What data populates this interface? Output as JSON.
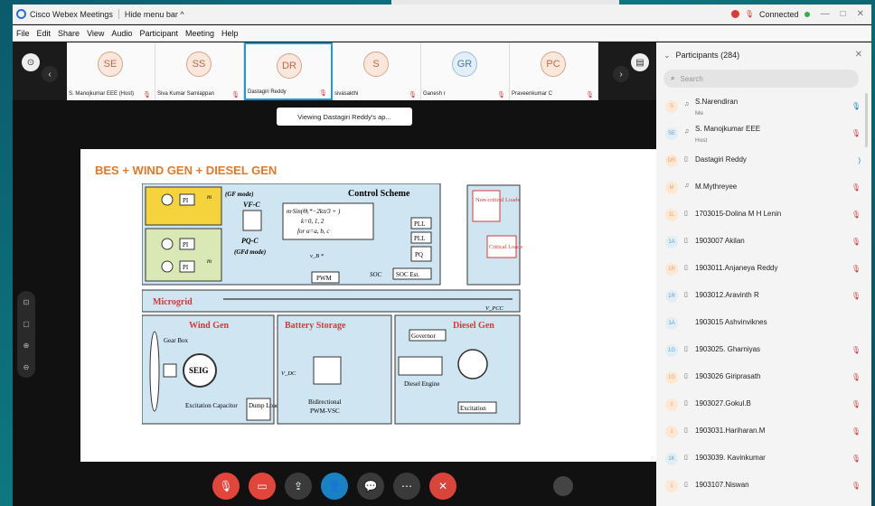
{
  "window": {
    "app_title": "Cisco Webex Meetings",
    "hide_menu": "Hide menu bar ^",
    "status": "Connected"
  },
  "menu": [
    "File",
    "Edit",
    "Share",
    "View",
    "Audio",
    "Participant",
    "Meeting",
    "Help"
  ],
  "thumbnails": [
    {
      "initials": "SE",
      "name": "S. Manojkumar EEE (Host)",
      "color": "orange"
    },
    {
      "initials": "SS",
      "name": "Siva Kumar Samiappan",
      "color": "orange"
    },
    {
      "initials": "DR",
      "name": "Dastagiri Reddy",
      "color": "orange",
      "active": true
    },
    {
      "initials": "S",
      "name": "sivasakthi",
      "color": "orange"
    },
    {
      "initials": "GR",
      "name": "Ganesh r",
      "color": "blue"
    },
    {
      "initials": "PC",
      "name": "Praveenkumar C",
      "color": "orange"
    }
  ],
  "toast": "Viewing Dastagiri Reddy's ap...",
  "slide": {
    "title": "BES + WIND GEN + DIESEL GEN",
    "control_scheme": "Control Scheme",
    "gf_mode": "(GF mode)",
    "vf_c": "VF-C",
    "pq_c": "PQ-C",
    "gfd_mode": "(GFd mode)",
    "formula_1": "m·Sin(Θₑ*−2kπ/3 + )",
    "formula_2": "k=0, 1, 2",
    "formula_3": "for α=a, b, c",
    "pwm": "PWM",
    "pll": "PLL",
    "pq": "PQ",
    "soc_est": "SOC Est.",
    "soc": "SOC",
    "non_critical": "Non-critical Loads",
    "critical": "Critical Loads",
    "microgrid": "Microgrid",
    "vpcc": "V_PCC",
    "wind_gen": "Wind Gen",
    "battery_storage": "Battery Storage",
    "diesel_gen": "Diesel Gen",
    "gear_box": "Gear Box",
    "seig": "SEIG",
    "excitation_capacitor": "Excitation Capacitor",
    "dump_load": "Dump Load",
    "vdc": "V_DC",
    "bidirectional": "Bidirectional",
    "pwm_vsc": "PWM-VSC",
    "governor": "Governor",
    "diesel_engine": "Diesel Engine",
    "excitation": "Excitation",
    "pi": "PI",
    "m": "m",
    "vb": "v_B *"
  },
  "controls": [
    "mute",
    "video",
    "share",
    "participants",
    "chat",
    "more",
    "leave"
  ],
  "panel": {
    "title": "Participants (284)",
    "search_placeholder": "Search",
    "participants": [
      {
        "initials": "S",
        "name": "S.Narendiran",
        "sub": "Me",
        "dev": "audio",
        "mic": "speaking",
        "color": "o"
      },
      {
        "initials": "SE",
        "name": "S. Manojkumar EEE",
        "sub": "Host",
        "dev": "audio",
        "mic": "muted",
        "color": "b"
      },
      {
        "initials": "DR",
        "name": "Dastagiri Reddy",
        "sub": "",
        "dev": "screen",
        "mic": "on",
        "color": "o"
      },
      {
        "initials": "M",
        "name": "M.Mythreyee",
        "sub": "",
        "dev": "audio",
        "mic": "muted",
        "color": "o"
      },
      {
        "initials": "1L",
        "name": "1703015-Dolina M H Lenin",
        "sub": "",
        "dev": "screen",
        "mic": "muted",
        "color": "o"
      },
      {
        "initials": "1A",
        "name": "1903007 Akilan",
        "sub": "",
        "dev": "screen",
        "mic": "muted",
        "color": "b"
      },
      {
        "initials": "1R",
        "name": "1903011.Anjaneya Reddy",
        "sub": "",
        "dev": "screen",
        "mic": "muted",
        "color": "o"
      },
      {
        "initials": "1R",
        "name": "1903012.Aravinth R",
        "sub": "",
        "dev": "screen",
        "mic": "muted",
        "color": "b"
      },
      {
        "initials": "1A",
        "name": "1903015 Ashvinviknes",
        "sub": "",
        "dev": "",
        "mic": "",
        "color": "b"
      },
      {
        "initials": "1G",
        "name": "1903025. Gharniyas",
        "sub": "",
        "dev": "screen",
        "mic": "muted",
        "color": "b"
      },
      {
        "initials": "1G",
        "name": "1903026 Giriprasath",
        "sub": "",
        "dev": "screen",
        "mic": "muted",
        "color": "o"
      },
      {
        "initials": "1",
        "name": "1903027.Gokul.B",
        "sub": "",
        "dev": "screen",
        "mic": "muted",
        "color": "o"
      },
      {
        "initials": "1",
        "name": "1903031.Hariharan.M",
        "sub": "",
        "dev": "screen",
        "mic": "muted",
        "color": "o"
      },
      {
        "initials": "1K",
        "name": "1903039. Kavinkumar",
        "sub": "",
        "dev": "screen",
        "mic": "muted",
        "color": "b"
      },
      {
        "initials": "1",
        "name": "1903107.Niswan",
        "sub": "",
        "dev": "screen",
        "mic": "muted",
        "color": "o"
      }
    ]
  }
}
